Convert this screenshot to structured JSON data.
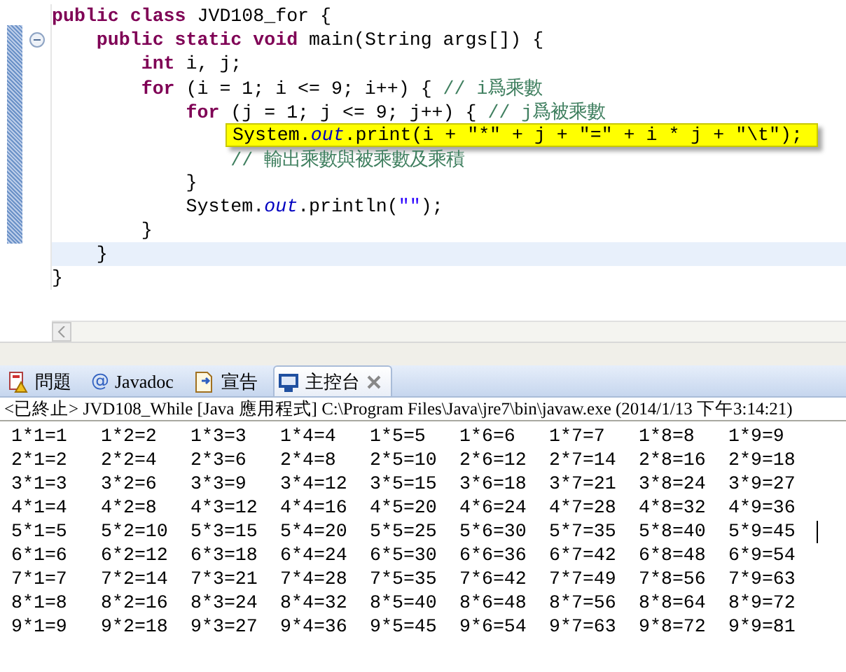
{
  "editor": {
    "lines": [
      {
        "kind": "code",
        "current": false,
        "collapsible": false,
        "tokens": [
          {
            "kind": "keyword",
            "text": "public class"
          },
          {
            "kind": "plain",
            "text": " JVD108_for {"
          }
        ]
      },
      {
        "kind": "code",
        "current": false,
        "collapsible": true,
        "tokens": [
          {
            "kind": "keyword",
            "text": "    public static void"
          },
          {
            "kind": "plain",
            "text": " main(String args[]) {"
          }
        ]
      },
      {
        "kind": "code",
        "current": false,
        "collapsible": false,
        "tokens": [
          {
            "kind": "keyword",
            "text": "        int"
          },
          {
            "kind": "plain",
            "text": " i, j;"
          }
        ]
      },
      {
        "kind": "code",
        "current": false,
        "collapsible": false,
        "tokens": [
          {
            "kind": "keyword",
            "text": "        for"
          },
          {
            "kind": "plain",
            "text": " (i = 1; i <= 9; i++) { "
          },
          {
            "kind": "comment",
            "text": "// i爲乘數"
          }
        ]
      },
      {
        "kind": "code",
        "current": false,
        "collapsible": false,
        "tokens": [
          {
            "kind": "keyword",
            "text": "            for"
          },
          {
            "kind": "plain",
            "text": " (j = 1; j <= 9; j++) { "
          },
          {
            "kind": "comment",
            "text": "// j爲被乘數"
          }
        ]
      },
      {
        "kind": "popup",
        "current": false,
        "collapsible": false,
        "tokens": [
          {
            "kind": "plain",
            "text": "System."
          },
          {
            "kind": "field",
            "text": "out"
          },
          {
            "kind": "plain",
            "text": ".print(i + \"*\" + j + \"=\" + i * j + \"\\t\");"
          }
        ]
      },
      {
        "kind": "code",
        "current": false,
        "collapsible": false,
        "tokens": [
          {
            "kind": "comment",
            "text": "                // 輸出乘數與被乘數及乘積"
          }
        ]
      },
      {
        "kind": "code",
        "current": false,
        "collapsible": false,
        "tokens": [
          {
            "kind": "plain",
            "text": "            }"
          }
        ]
      },
      {
        "kind": "code",
        "current": false,
        "collapsible": false,
        "tokens": [
          {
            "kind": "plain",
            "text": "            System."
          },
          {
            "kind": "field",
            "text": "out"
          },
          {
            "kind": "plain",
            "text": ".println("
          },
          {
            "kind": "string",
            "text": "\"\""
          },
          {
            "kind": "plain",
            "text": ");"
          }
        ]
      },
      {
        "kind": "code",
        "current": false,
        "collapsible": false,
        "tokens": [
          {
            "kind": "plain",
            "text": "        }"
          }
        ]
      },
      {
        "kind": "code",
        "current": true,
        "collapsible": false,
        "tokens": [
          {
            "kind": "plain",
            "text": "    }"
          }
        ]
      },
      {
        "kind": "code",
        "current": false,
        "collapsible": false,
        "tokens": [
          {
            "kind": "plain",
            "text": "}"
          }
        ]
      }
    ]
  },
  "tabs": [
    {
      "label": "問題",
      "selected": false
    },
    {
      "symbol": "@",
      "label": "Javadoc",
      "selected": false
    },
    {
      "label": "宣告",
      "selected": false
    },
    {
      "label": "主控台",
      "selected": true
    }
  ],
  "console": {
    "status": "<已終止> JVD108_While [Java 應用程式] C:\\Program Files\\Java\\jre7\\bin\\javaw.exe (2014/1/13 下午3:14:21)",
    "rows": [
      [
        "1*1=1",
        "1*2=2",
        "1*3=3",
        "1*4=4",
        "1*5=5",
        "1*6=6",
        "1*7=7",
        "1*8=8",
        "1*9=9"
      ],
      [
        "2*1=2",
        "2*2=4",
        "2*3=6",
        "2*4=8",
        "2*5=10",
        "2*6=12",
        "2*7=14",
        "2*8=16",
        "2*9=18"
      ],
      [
        "3*1=3",
        "3*2=6",
        "3*3=9",
        "3*4=12",
        "3*5=15",
        "3*6=18",
        "3*7=21",
        "3*8=24",
        "3*9=27"
      ],
      [
        "4*1=4",
        "4*2=8",
        "4*3=12",
        "4*4=16",
        "4*5=20",
        "4*6=24",
        "4*7=28",
        "4*8=32",
        "4*9=36"
      ],
      [
        "5*1=5",
        "5*2=10",
        "5*3=15",
        "5*4=20",
        "5*5=25",
        "5*6=30",
        "5*7=35",
        "5*8=40",
        "5*9=45"
      ],
      [
        "6*1=6",
        "6*2=12",
        "6*3=18",
        "6*4=24",
        "6*5=30",
        "6*6=36",
        "6*7=42",
        "6*8=48",
        "6*9=54"
      ],
      [
        "7*1=7",
        "7*2=14",
        "7*3=21",
        "7*4=28",
        "7*5=35",
        "7*6=42",
        "7*7=49",
        "7*8=56",
        "7*9=63"
      ],
      [
        "8*1=8",
        "8*2=16",
        "8*3=24",
        "8*4=32",
        "8*5=40",
        "8*6=48",
        "8*7=56",
        "8*8=64",
        "8*9=72"
      ],
      [
        "9*1=9",
        "9*2=18",
        "9*3=27",
        "9*4=36",
        "9*5=45",
        "9*6=54",
        "9*7=63",
        "9*8=72",
        "9*9=81"
      ]
    ]
  }
}
